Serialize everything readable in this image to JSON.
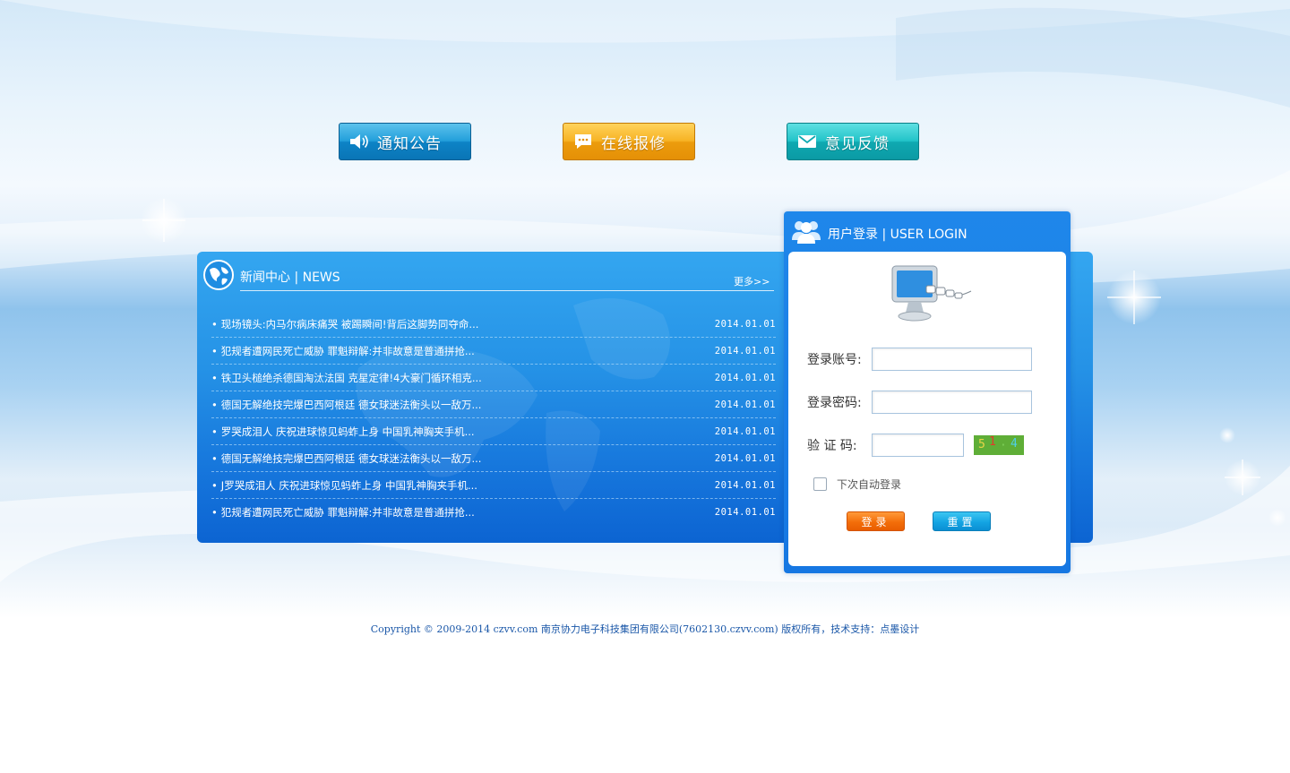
{
  "quick_links": [
    {
      "label": "通知公告",
      "icon": "speaker-icon"
    },
    {
      "label": "在线报修",
      "icon": "chat-bubble-icon"
    },
    {
      "label": "意见反馈",
      "icon": "envelope-icon"
    }
  ],
  "news": {
    "title": "新闻中心 | NEWS",
    "more": "更多>>",
    "items": [
      {
        "title": "现场镜头:内马尔病床痛哭 被踢瞬间!背后这脚势同夺命...",
        "date": "2014.01.01"
      },
      {
        "title": "犯规者遭网民死亡威胁 罪魁辩解:并非故意是普通拼抢...",
        "date": "2014.01.01"
      },
      {
        "title": "铁卫头槌绝杀德国淘汰法国 克星定律!4大豪门循环相克...",
        "date": "2014.01.01"
      },
      {
        "title": "德国无解绝技完爆巴西阿根廷 德女球迷法衡头以一敌万...",
        "date": "2014.01.01"
      },
      {
        "title": "罗哭成泪人 庆祝进球惊见蚂蚱上身 中国乳神胸夹手机...",
        "date": "2014.01.01"
      },
      {
        "title": "德国无解绝技完爆巴西阿根廷 德女球迷法衡头以一敌万...",
        "date": "2014.01.01"
      },
      {
        "title": "J罗哭成泪人 庆祝进球惊见蚂蚱上身 中国乳神胸夹手机...",
        "date": "2014.01.01"
      },
      {
        "title": "犯规者遭网民死亡威胁 罪魁辩解:并非故意是普通拼抢...",
        "date": "2014.01.01"
      }
    ]
  },
  "login": {
    "title": "用户登录 | USER LOGIN",
    "account_label": "登录账号:",
    "account_value": "",
    "password_label": "登录密码:",
    "password_value": "",
    "captcha_label": "验 证 码:",
    "captcha_value": "",
    "captcha_chars": [
      "5",
      "1",
      "·",
      "4"
    ],
    "remember_label": "下次自动登录",
    "remember_checked": false,
    "login_button": "登录",
    "reset_button": "重置"
  },
  "footer": {
    "text": "Copyright © 2009-2014 czvv.com 南京协力电子科技集团有限公司(7602130.czvv.com) 版权所有，技术支持：点墨设计"
  },
  "colors": {
    "panel_blue": "#1677e2",
    "notice_button": "#239fdb",
    "repair_button": "#f7b324",
    "feedback_button": "#23c4c9",
    "login_button": "#f36e0a",
    "reset_button": "#14a4e3"
  }
}
